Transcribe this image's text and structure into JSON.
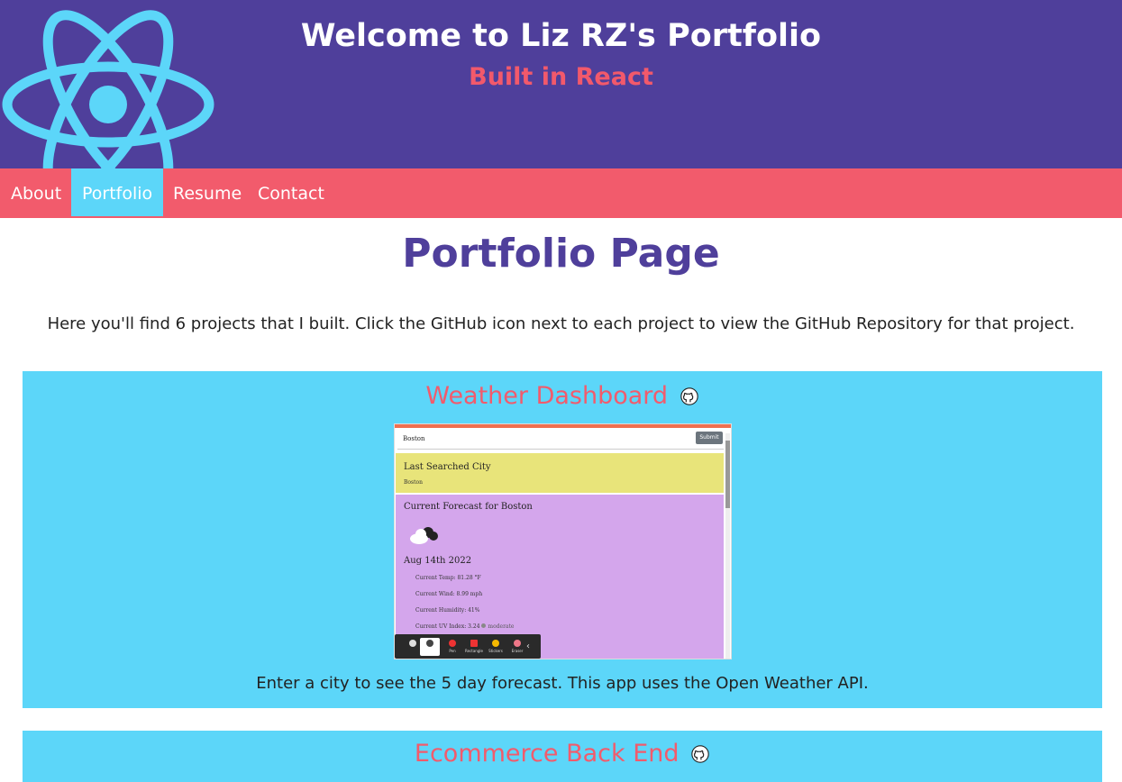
{
  "header": {
    "title": "Welcome to Liz RZ's Portfolio",
    "subtitle": "Built in React",
    "logo_icon": "react-atom-logo"
  },
  "nav": {
    "items": [
      {
        "label": "About",
        "active": false
      },
      {
        "label": "Portfolio",
        "active": true
      },
      {
        "label": "Resume",
        "active": false
      },
      {
        "label": "Contact",
        "active": false
      }
    ]
  },
  "main": {
    "title": "Portfolio Page",
    "intro": "Here you'll find 6 projects that I built. Click the GitHub icon next to each project to view the GitHub Repository for that project.",
    "projects": [
      {
        "title": "Weather Dashboard",
        "icon": "github-icon",
        "description": "Enter a city to see the 5 day forecast. This app uses the Open Weather API.",
        "screenshot": {
          "search_value": "Boston",
          "submit_label": "Submit",
          "last_searched_heading": "Last Searched City",
          "last_searched_city": "Boston",
          "current_heading": "Current Forecast for Boston",
          "date": "Aug 14th 2022",
          "temp": "Current Temp: 81.28 °F",
          "wind": "Current Wind: 8.99 mph",
          "humidity": "Current Humidity: 41%",
          "uv": "Current UV Index: 3.24",
          "uv_level": "moderate",
          "toolbar": [
            "Pen",
            "Rectangle",
            "Stickers",
            "Eraser"
          ]
        }
      },
      {
        "title": "Ecommerce Back End",
        "icon": "github-icon"
      }
    ]
  },
  "colors": {
    "header_bg": "#4f3f9b",
    "accent": "#f25b6c",
    "nav_active": "#5cd6f9",
    "card_bg": "#5cd6f9",
    "logo": "#5cd6f9"
  }
}
